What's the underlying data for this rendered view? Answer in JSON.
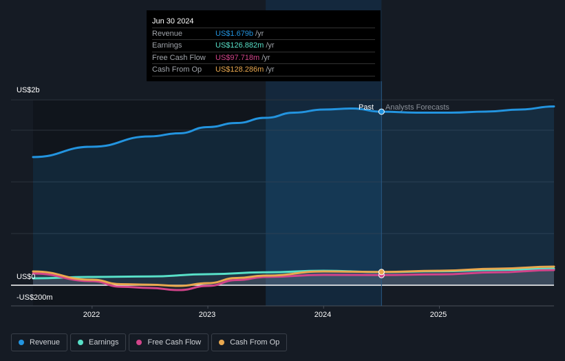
{
  "chart_data": {
    "type": "line",
    "title": "",
    "xlabel": "",
    "ylabel": "",
    "xlim": [
      2021.49,
      2025.99
    ],
    "ylim": [
      -0.2,
      1.793
    ],
    "y_unit": "US$ billions",
    "y_tick_labels": [
      {
        "value": 1.793,
        "label": "US$2b"
      },
      {
        "value": 0,
        "label": "US$0"
      },
      {
        "value": -0.2,
        "label": "-US$200m"
      }
    ],
    "gridlines": [
      0.5,
      1.0,
      1.5,
      1.793
    ],
    "x_ticks": [
      2022,
      2023,
      2024,
      2025
    ],
    "x_tick_labels": [
      "2022",
      "2023",
      "2024",
      "2025"
    ],
    "past_label": "Past",
    "forecast_label": "Analysts Forecasts",
    "divider_x": 2024.5,
    "highlight_range": [
      2023.5,
      2024.5
    ],
    "series": [
      {
        "name": "Revenue",
        "color": "#2394df",
        "x": [
          2021.49,
          2022,
          2022.5,
          2022.75,
          2023,
          2023.25,
          2023.5,
          2023.75,
          2024,
          2024.25,
          2024.5,
          2024.8,
          2025.1,
          2025.4,
          2025.7,
          2025.99
        ],
        "y": [
          1.24,
          1.34,
          1.44,
          1.47,
          1.53,
          1.57,
          1.62,
          1.67,
          1.7,
          1.71,
          1.679,
          1.67,
          1.67,
          1.68,
          1.7,
          1.73
        ]
      },
      {
        "name": "Earnings",
        "color": "#58e0c8",
        "x": [
          2021.49,
          2022,
          2022.5,
          2023,
          2023.5,
          2024,
          2024.5,
          2025,
          2025.5,
          2025.99
        ],
        "y": [
          0.067,
          0.08,
          0.085,
          0.107,
          0.125,
          0.14,
          0.127,
          0.135,
          0.148,
          0.16
        ]
      },
      {
        "name": "Free Cash Flow",
        "color": "#d2448a",
        "x": [
          2021.49,
          2022,
          2022.25,
          2022.5,
          2022.75,
          2023,
          2023.25,
          2023.5,
          2024,
          2024.5,
          2025,
          2025.5,
          2025.99
        ],
        "y": [
          0.113,
          0.04,
          -0.015,
          -0.027,
          -0.047,
          -0.007,
          0.05,
          0.08,
          0.1,
          0.098,
          0.105,
          0.125,
          0.147
        ]
      },
      {
        "name": "Cash From Op",
        "color": "#e9a84f",
        "x": [
          2021.49,
          2022,
          2022.25,
          2022.5,
          2022.75,
          2023,
          2023.25,
          2023.5,
          2024,
          2024.5,
          2025,
          2025.5,
          2025.99
        ],
        "y": [
          0.133,
          0.053,
          0.01,
          0.005,
          -0.007,
          0.02,
          0.07,
          0.093,
          0.133,
          0.128,
          0.14,
          0.16,
          0.18
        ]
      }
    ]
  },
  "tooltip": {
    "date": "Jun 30 2024",
    "rows": [
      {
        "label": "Revenue",
        "value": "US$1.679b",
        "unit": "/yr",
        "color": "#2394df"
      },
      {
        "label": "Earnings",
        "value": "US$126.882m",
        "unit": "/yr",
        "color": "#58e0c8"
      },
      {
        "label": "Free Cash Flow",
        "value": "US$97.718m",
        "unit": "/yr",
        "color": "#d2448a"
      },
      {
        "label": "Cash From Op",
        "value": "US$128.286m",
        "unit": "/yr",
        "color": "#e9a84f"
      }
    ]
  },
  "legend": [
    "Revenue",
    "Earnings",
    "Free Cash Flow",
    "Cash From Op"
  ]
}
